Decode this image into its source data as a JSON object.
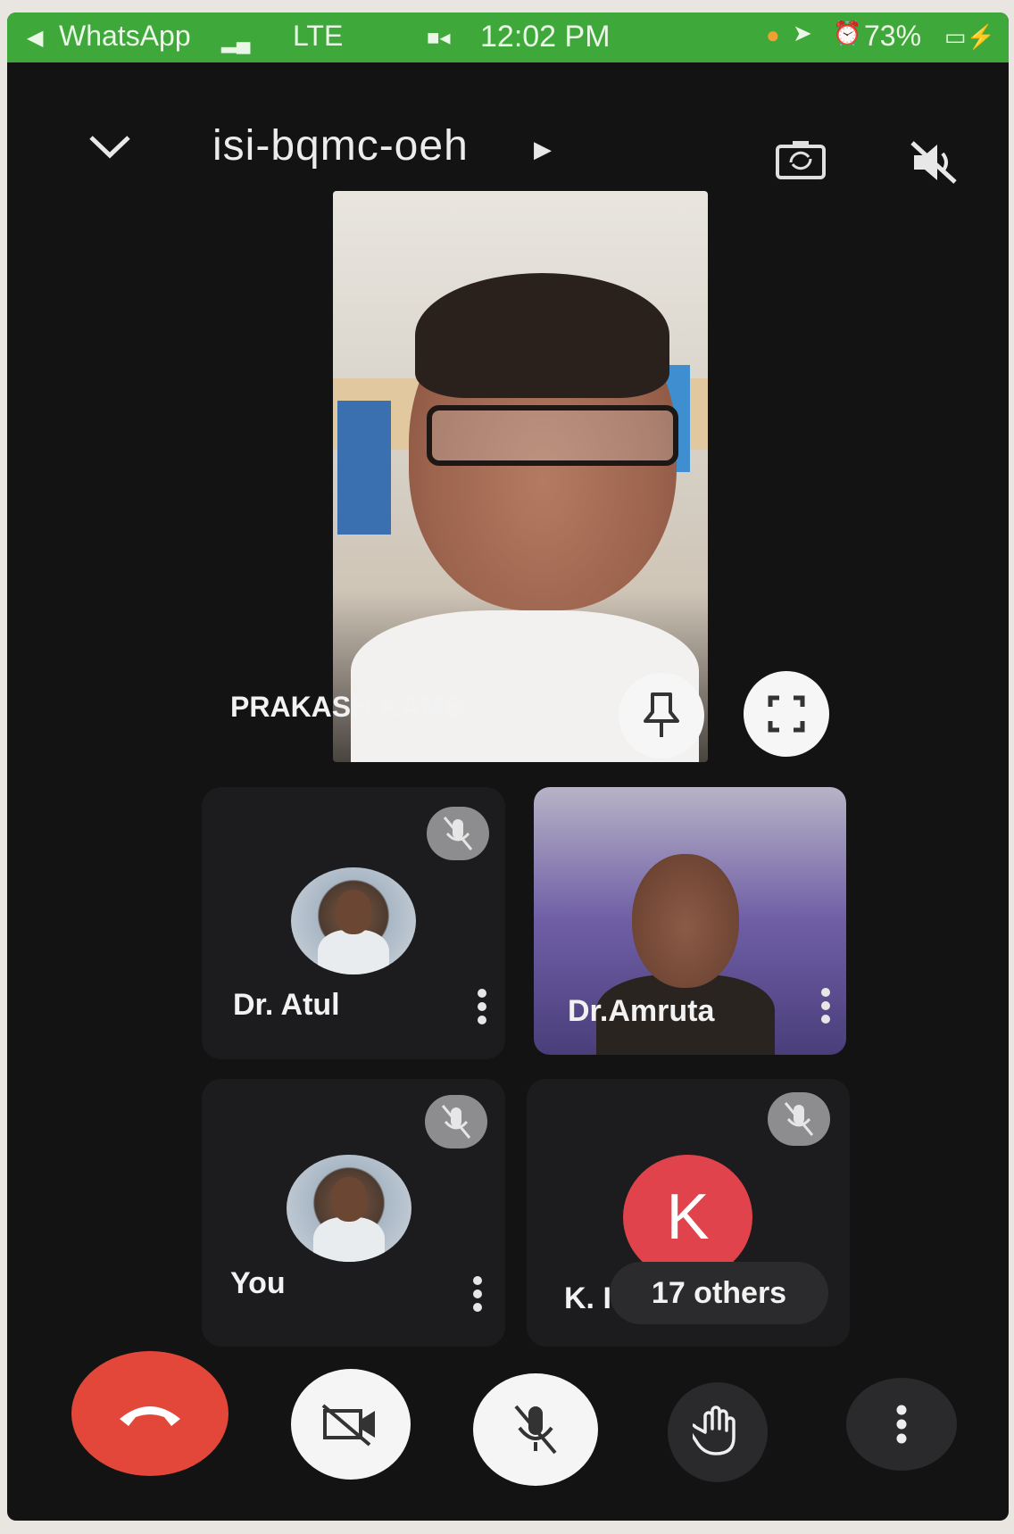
{
  "status_bar": {
    "back_app": "WhatsApp",
    "network": "LTE",
    "time": "12:02 PM",
    "battery": "73%"
  },
  "top_bar": {
    "meeting_code": "isi-bqmc-oeh"
  },
  "main_tile": {
    "name": "PRAKASH KAMB..."
  },
  "participants": [
    {
      "name": "Dr. Atul"
    },
    {
      "name": "Dr.Amruta"
    },
    {
      "name": "You"
    }
  ],
  "others_tile": {
    "initial": "K",
    "name_fragment": "K. I",
    "others_label": "17 others"
  },
  "colors": {
    "status_bar": "#3fa83a",
    "end_call": "#e2473a",
    "avatar_k": "#e1434c",
    "background": "#131313"
  }
}
